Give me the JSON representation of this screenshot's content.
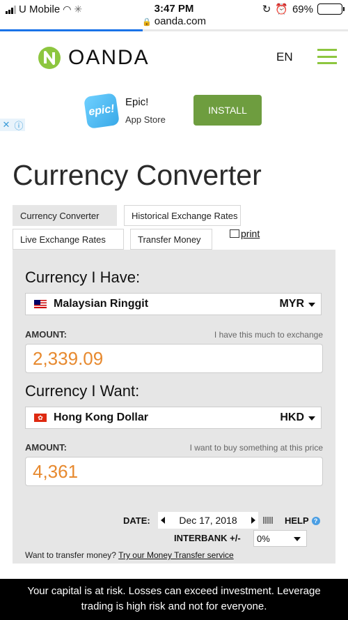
{
  "status_bar": {
    "carrier": "U Mobile",
    "time": "3:47 PM",
    "battery": "69%",
    "battery_level": 0.69
  },
  "browser": {
    "url": "oanda.com",
    "load_progress": 0.41
  },
  "header": {
    "brand": "OANDA",
    "language": "EN",
    "accent_color": "#8dc63f"
  },
  "ad": {
    "app_icon_text": "epic!",
    "title": "Epic!",
    "subtitle": "App Store",
    "install_label": "INSTALL",
    "install_color": "#6e9d3f"
  },
  "page": {
    "title": "Currency Converter"
  },
  "tabs": [
    {
      "label": "Currency Converter",
      "active": true
    },
    {
      "label": "Historical Exchange Rates",
      "active": false
    },
    {
      "label": "Live Exchange Rates",
      "active": false
    },
    {
      "label": "Transfer Money",
      "active": false
    }
  ],
  "print_label": "print",
  "converter": {
    "have": {
      "heading": "Currency I Have:",
      "currency_name": "Malaysian Ringgit",
      "currency_code": "MYR",
      "amount_label": "AMOUNT:",
      "amount_hint": "I have this much to exchange",
      "amount": "2,339.09"
    },
    "want": {
      "heading": "Currency I Want:",
      "currency_name": "Hong Kong Dollar",
      "currency_code": "HKD",
      "amount_label": "AMOUNT:",
      "amount_hint": "I want to buy something at this price",
      "amount": "4,361"
    },
    "amount_color": "#e7892e",
    "date_label": "DATE:",
    "date": "Dec 17, 2018",
    "help_label": "HELP",
    "interbank_label": "INTERBANK +/-",
    "interbank_value": "0%",
    "transfer_prompt": "Want to transfer money?",
    "transfer_link": "Try our Money Transfer service"
  },
  "risk_banner": "Your capital is at risk. Losses can exceed investment. Leverage trading is high risk and not for everyone."
}
